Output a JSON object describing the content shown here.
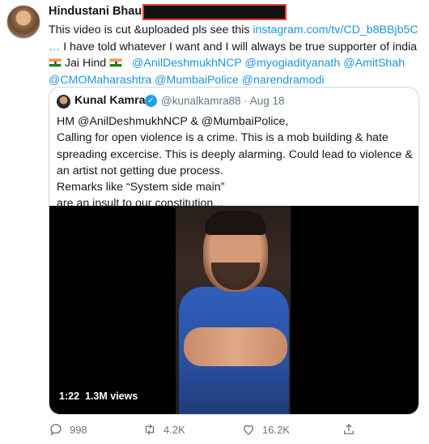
{
  "author": {
    "name": "Hindustani Bhau"
  },
  "tweet": {
    "text_lead": "This video is cut &uploaded  pls see this ",
    "link": "instagram.com/tv/CD_b8BBjb5C",
    "ellipsis": "…",
    "text_mid": " I have told whatever I want and I will always be true supporter of india ",
    "jai_hind": " Jai Hind ",
    "mentions": [
      "@AnilDeshmukhNCP",
      "@myogiadityanath",
      "@AmitShah",
      "@CMOMaharashtra",
      "@MumbaiPolice",
      "@narendramodi"
    ]
  },
  "quoted": {
    "name": "Kunal Kamra",
    "handle": "@kunalkamra88 · Aug 18",
    "lines": [
      "HM @AnilDeshmukhNCP & @MumbaiPolice,",
      "Calling for open violence is a crime. This is a mob building & hate spreading excercise. This is deeply alarming. Could lead to violence & an artist not getting due process.",
      "Remarks like “System side main”",
      "are an insult to our constitution..."
    ],
    "video": {
      "time": "1:22",
      "views": "1.3M views"
    }
  },
  "actions": {
    "reply_count": "998",
    "retweet_count": "4.2K",
    "like_count": "16.2K"
  },
  "colors": {
    "link": "#1b95e0",
    "secondary": "#657786",
    "verified": "#1da1f2"
  },
  "icons": [
    "reply-icon",
    "retweet-icon",
    "like-icon",
    "share-icon",
    "verified-badge-icon",
    "india-flag-icon"
  ]
}
